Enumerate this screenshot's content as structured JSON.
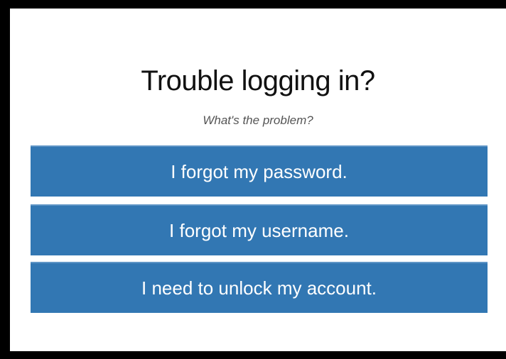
{
  "title": "Trouble logging in?",
  "subtitle": "What's the problem?",
  "options": [
    {
      "label": "I forgot my password."
    },
    {
      "label": "I forgot my username."
    },
    {
      "label": "I need to unlock my account."
    }
  ],
  "colors": {
    "button": "#3277b3",
    "button_text": "#ffffff",
    "title": "#111111",
    "subtitle": "#555555",
    "frame": "#000000",
    "panel": "#ffffff"
  }
}
